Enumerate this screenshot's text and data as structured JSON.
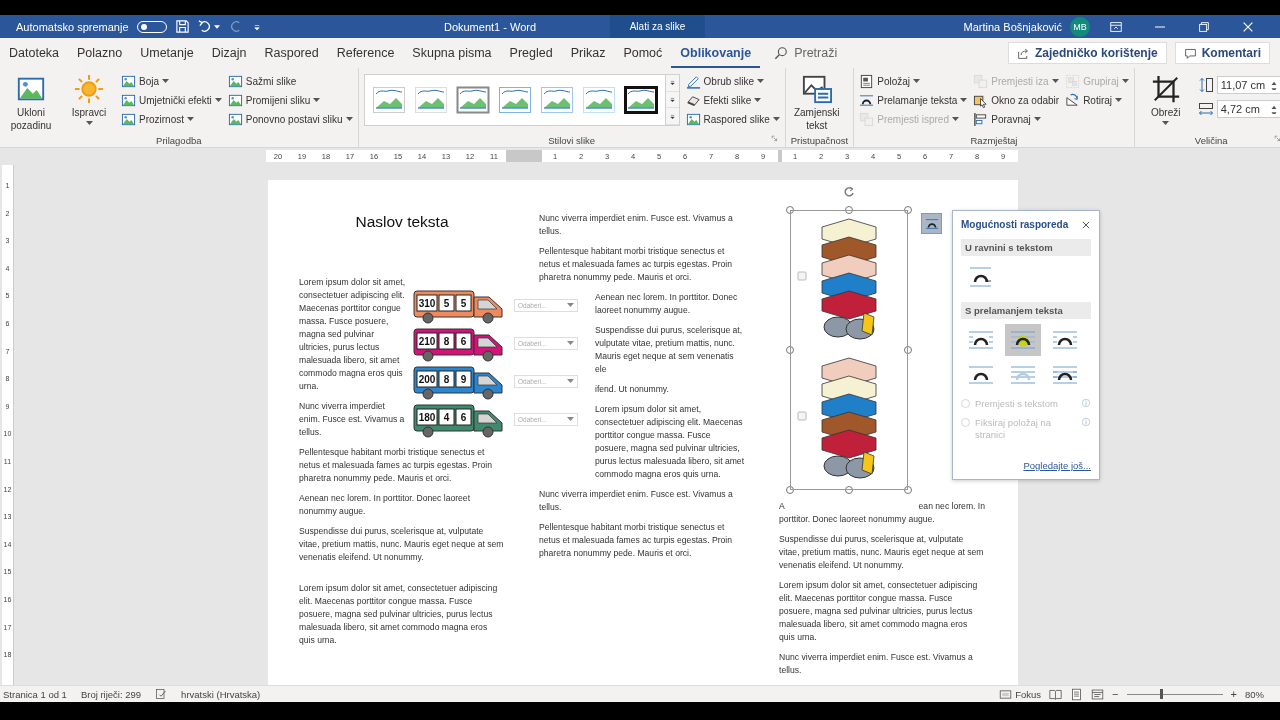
{
  "title_bar": {
    "autosave_label": "Automatsko spremanje",
    "autosave_on": false,
    "document_title": "Dokument1  -  Word",
    "context_tab": "Alati za slike",
    "user_name": "Martina Bošnjaković",
    "user_initials": "MB"
  },
  "menu_tabs": [
    {
      "label": "Datoteka",
      "selected": false
    },
    {
      "label": "Polazno",
      "selected": false
    },
    {
      "label": "Umetanje",
      "selected": false
    },
    {
      "label": "Dizajn",
      "selected": false
    },
    {
      "label": "Raspored",
      "selected": false
    },
    {
      "label": "Reference",
      "selected": false
    },
    {
      "label": "Skupna pisma",
      "selected": false
    },
    {
      "label": "Pregled",
      "selected": false
    },
    {
      "label": "Prikaz",
      "selected": false
    },
    {
      "label": "Pomoć",
      "selected": false
    },
    {
      "label": "Oblikovanje",
      "selected": true
    }
  ],
  "search": {
    "placeholder": "Pretraži"
  },
  "share_button": "Zajedničko korištenje",
  "comments_button": "Komentari",
  "ribbon": {
    "groups": [
      {
        "title": "Prilagodba",
        "launcher": false,
        "items": [
          {
            "kind": "large",
            "label": "Ukloni pozadinu",
            "dropdown": false
          },
          {
            "kind": "large",
            "label": "Ispravci",
            "dropdown": true
          },
          {
            "kind": "stack",
            "buttons": [
              {
                "label": "Boja",
                "dropdown": true,
                "disabled": false
              },
              {
                "label": "Umjetnički efekti",
                "dropdown": true,
                "disabled": false
              },
              {
                "label": "Prozirnost",
                "dropdown": true,
                "disabled": false
              }
            ]
          },
          {
            "kind": "stack",
            "buttons": [
              {
                "label": "Sažmi slike",
                "dropdown": false,
                "disabled": false
              },
              {
                "label": "Promijeni sliku",
                "dropdown": true,
                "disabled": false
              },
              {
                "label": "Ponovno postavi sliku",
                "dropdown": true,
                "disabled": false
              }
            ]
          }
        ]
      },
      {
        "title": "Stilovi slike",
        "launcher": true,
        "items": [
          {
            "kind": "gallery"
          },
          {
            "kind": "stack",
            "buttons": [
              {
                "label": "Obrub slike",
                "dropdown": true,
                "disabled": false
              },
              {
                "label": "Efekti slike",
                "dropdown": true,
                "disabled": false
              },
              {
                "label": "Raspored slike",
                "dropdown": true,
                "disabled": false
              }
            ]
          }
        ]
      },
      {
        "title": "Pristupačnost",
        "launcher": false,
        "items": [
          {
            "kind": "large",
            "label": "Zamjenski tekst",
            "dropdown": false
          }
        ]
      },
      {
        "title": "Razmještaj",
        "launcher": false,
        "items": [
          {
            "kind": "stack",
            "buttons": [
              {
                "label": "Položaj",
                "dropdown": true,
                "disabled": false
              },
              {
                "label": "Prelamanje teksta",
                "dropdown": true,
                "disabled": false
              },
              {
                "label": "Premjesti ispred",
                "dropdown": true,
                "disabled": true
              }
            ]
          },
          {
            "kind": "stack",
            "buttons": [
              {
                "label": "Premjesti iza",
                "dropdown": true,
                "disabled": true
              },
              {
                "label": "Okno za odabir",
                "dropdown": false,
                "disabled": false
              },
              {
                "label": "Poravnaj",
                "dropdown": true,
                "disabled": false
              }
            ]
          },
          {
            "kind": "stack",
            "buttons": [
              {
                "label": "Grupiraj",
                "dropdown": true,
                "disabled": true
              },
              {
                "label": "Rotiraj",
                "dropdown": true,
                "disabled": false
              }
            ]
          }
        ]
      },
      {
        "title": "Veličina",
        "launcher": true,
        "items": [
          {
            "kind": "large",
            "label": "Obreži",
            "dropdown": true
          },
          {
            "kind": "size",
            "fields": [
              {
                "value": "11,07 cm"
              },
              {
                "value": "4,72 cm"
              }
            ]
          }
        ]
      }
    ]
  },
  "ruler": {
    "left_numbers": [
      "20",
      "19",
      "18",
      "17",
      "16",
      "15",
      "14",
      "13",
      "12",
      "11"
    ],
    "middle_numbers": [
      "1",
      "2",
      "3",
      "4",
      "5",
      "6",
      "7",
      "8",
      "9"
    ],
    "right_numbers": [
      "1",
      "2",
      "3",
      "4",
      "5",
      "6",
      "7",
      "8",
      "9"
    ]
  },
  "vertical_ruler": {
    "numbers": [
      "1",
      "2",
      "3",
      "4",
      "5",
      "6",
      "7",
      "8",
      "9",
      "10",
      "11",
      "12",
      "13",
      "14",
      "15",
      "16",
      "17",
      "18"
    ]
  },
  "document": {
    "column_1": {
      "heading": "Naslov teksta",
      "trucks": [
        {
          "color": "#f08a5d",
          "numbers": [
            "310",
            "5",
            "5"
          ],
          "dropdown_placeholder": "Odaberi..."
        },
        {
          "color": "#d6127a",
          "numbers": [
            "210",
            "8",
            "6"
          ],
          "dropdown_placeholder": "Odaberi..."
        },
        {
          "color": "#2a86d1",
          "numbers": [
            "200",
            "8",
            "9"
          ],
          "dropdown_placeholder": "Odaberi..."
        },
        {
          "color": "#3f8a6e",
          "numbers": [
            "180",
            "4",
            "6"
          ],
          "dropdown_placeholder": "Odaberi..."
        }
      ],
      "paragraphs": [
        "Lorem ipsum dolor sit amet, consectetuer adipiscing elit. Maecenas porttitor congue massa. Fusce posuere, magna sed pulvinar ultricies, purus lectus malesuada libero, sit amet commodo magna eros quis urna.",
        "Nunc viverra imperdiet enim. Fusce est. Vivamus a tellus.",
        "Pellentesque habitant morbi tristique senectus et netus et malesuada fames ac turpis egestas. Proin pharetra nonummy pede. Mauris et orci.",
        "Aenean nec lorem. In porttitor. Donec laoreet nonummy augue.",
        "Suspendisse dui purus, scelerisque at, vulputate vitae, pretium mattis, nunc. Mauris eget neque at sem venenatis eleifend. Ut nonummy.",
        "Lorem ipsum dolor sit amet, consectetuer adipiscing elit. Maecenas porttitor congue massa. Fusce posuere, magna sed pulvinar ultricies, purus lectus malesuada libero, sit amet commodo magna eros quis urna."
      ]
    },
    "column_2": {
      "paragraphs": [
        "Nunc viverra imperdiet enim. Fusce est. Vivamus a tellus.",
        "Pellentesque habitant morbi tristique senectus et netus et malesuada fames ac turpis egestas. Proin pharetra nonummy pede. Mauris et orci.",
        "Aenean nec lorem. In porttitor. Donec laoreet nonummy augue.",
        "Suspendisse dui purus, scelerisque at, vulputate vitae, pretium mattis, nunc. Mauris eget neque at sem venenatis ele",
        "ifend. Ut nonummy.",
        "Lorem ipsum dolor sit amet, consectetuer adipiscing elit. Maecenas porttitor congue massa. Fusce posuere, magna sed pulvinar ultricies, purus lectus malesuada libero, sit amet commodo magna eros quis urna.",
        "Nunc viverra imperdiet enim. Fusce est. Vivamus a tellus.",
        "Pellentesque habitant morbi tristique senectus et netus et malesuada fames ac turpis egestas. Proin pharetra nonummy pede. Mauris et orci."
      ]
    },
    "column_3": {
      "partial_paragraph": {
        "start": "A",
        "end": "ean nec lorem. In",
        "rest": "porttitor. Donec laoreet nonummy augue."
      },
      "paragraphs": [
        "Suspendisse dui purus, scelerisque at, vulputate vitae, pretium mattis, nunc. Mauris eget neque at sem venenatis eleifend. Ut nonummy.",
        "Lorem ipsum dolor sit amet, consectetuer adipiscing elit. Maecenas porttitor congue massa. Fusce posuere, magna sed pulvinar ultricies, purus lectus malesuada libero, sit amet commodo magna eros quis urna.",
        "Nunc viverra imperdiet enim. Fusce est. Vivamus a tellus."
      ]
    }
  },
  "layout_options": {
    "title": "Mogućnosti rasporeda",
    "sections": [
      {
        "title": "U ravnini s tekstom",
        "options": [
          {
            "selected": false
          }
        ]
      },
      {
        "title": "S prelamanjem teksta",
        "options": [
          {
            "selected": false
          },
          {
            "selected": true
          },
          {
            "selected": false
          },
          {
            "selected": false
          },
          {
            "selected": false
          },
          {
            "selected": false
          }
        ]
      }
    ],
    "radios": [
      {
        "label": "Premjesti s tekstom",
        "checked": false,
        "disabled": true
      },
      {
        "label": "Fiksiraj položaj na stranici",
        "checked": false,
        "disabled": true
      }
    ],
    "link": "Pogledajte još..."
  },
  "status_bar": {
    "page": "Stranica 1 od 1",
    "words": "Broj riječi: 299",
    "language": "hrvatski (Hrvatska)",
    "focus": "Fokus",
    "zoom_out": "−",
    "zoom_in": "+",
    "zoom": {
      "level": 0.35,
      "reading": "80%"
    }
  }
}
